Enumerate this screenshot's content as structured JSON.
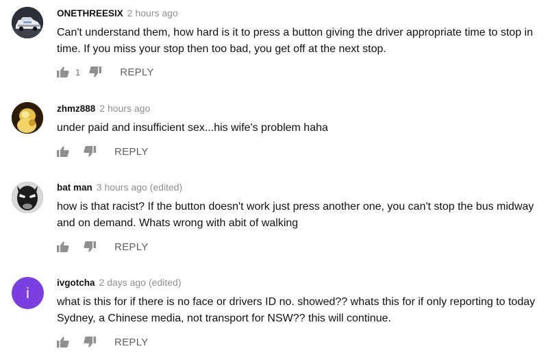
{
  "comments": [
    {
      "author": "ONETHREESIX",
      "time": "2 hours ago",
      "edited": "",
      "text": "Can't understand them, how hard is it to press a button giving the driver appropriate time to stop in time. If you miss your stop then too bad, you get off at the next stop.",
      "likes": "1",
      "reply_label": "REPLY",
      "avatar_icon": "car-photo-avatar"
    },
    {
      "author": "zhmz888",
      "time": "2 hours ago",
      "edited": "",
      "text": "under paid and insufficient sex...his wife's problem haha",
      "likes": "",
      "reply_label": "REPLY",
      "avatar_icon": "yellow-photo-avatar"
    },
    {
      "author": "bat man",
      "time": "3 hours ago",
      "edited": "(edited)",
      "text": "how is that racist? If the button doesn't work just press another one, you can't stop the bus midway and on demand. Whats wrong with abit of walking",
      "likes": "",
      "reply_label": "REPLY",
      "avatar_icon": "mask-photo-avatar"
    },
    {
      "author": "ivgotcha",
      "time": "2 days ago",
      "edited": "(edited)",
      "text": "what is this for if there is no face or drivers ID no. showed??  whats this for if only reporting to today Sydney, a Chinese media, not transport for NSW??  this will continue.",
      "likes": "",
      "reply_label": "REPLY",
      "avatar_letter": "i",
      "avatar_color": "#7b3fe0"
    }
  ]
}
